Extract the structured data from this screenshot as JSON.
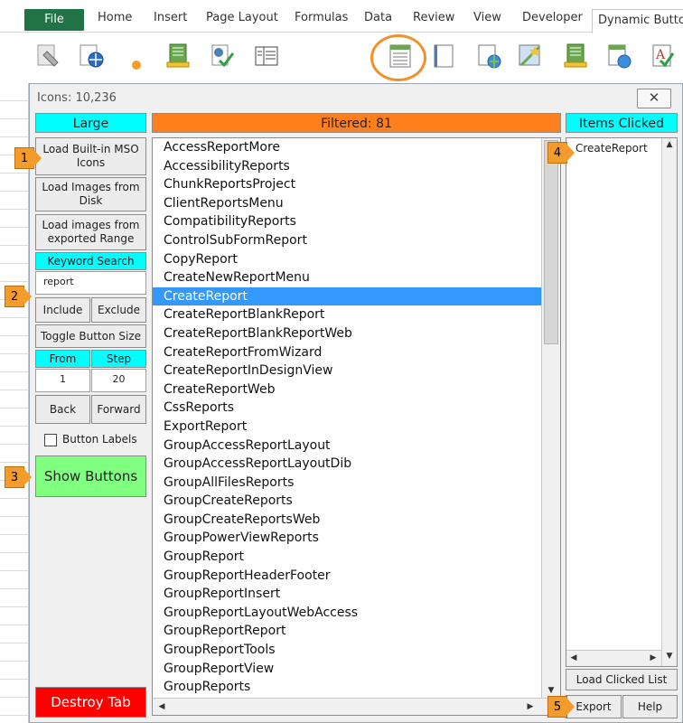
{
  "ribbon": {
    "tabs": [
      "File",
      "Home",
      "Insert",
      "Page Layout",
      "Formulas",
      "Data",
      "Review",
      "View",
      "Developer",
      "Dynamic Buttons"
    ],
    "accent": "#217346",
    "highlight_ring_color": "#f0922b"
  },
  "dialog": {
    "title": "Icons: 10,236",
    "close_label": "✕",
    "left": {
      "header": "Large",
      "load_mso": "Load Built-in MSO Icons",
      "load_disk": "Load Images from Disk",
      "load_range": "Load images from exported Range",
      "keyword_header": "Keyword Search",
      "keyword_value": "report",
      "include": "Include",
      "exclude": "Exclude",
      "toggle_size": "Toggle Button Size",
      "from_label": "From",
      "step_label": "Step",
      "from_value": "1",
      "step_value": "20",
      "back": "Back",
      "forward": "Forward",
      "button_labels": "Button Labels",
      "show_buttons": "Show Buttons",
      "destroy_tab": "Destroy Tab"
    },
    "filtered": {
      "header": "Filtered: 81",
      "items": [
        "AccessReportMore",
        "AccessibilityReports",
        "ChunkReportsProject",
        "ClientReportsMenu",
        "CompatibilityReports",
        "ControlSubFormReport",
        "CopyReport",
        "CreateNewReportMenu",
        "CreateReport",
        "CreateReportBlankReport",
        "CreateReportBlankReportWeb",
        "CreateReportFromWizard",
        "CreateReportInDesignView",
        "CreateReportWeb",
        "CssReports",
        "ExportReport",
        "GroupAccessReportLayout",
        "GroupAccessReportLayoutDib",
        "GroupAllFilesReports",
        "GroupCreateReports",
        "GroupCreateReportsWeb",
        "GroupPowerViewReports",
        "GroupReport",
        "GroupReportHeaderFooter",
        "GroupReportInsert",
        "GroupReportLayoutWebAccess",
        "GroupReportReport",
        "GroupReportTools",
        "GroupReportView",
        "GroupReports"
      ],
      "selected": "CreateReport"
    },
    "clicked": {
      "header": "Items Clicked",
      "items": [
        "CreateReport"
      ],
      "load_list": "Load Clicked List",
      "export": "Export",
      "help": "Help"
    },
    "callouts": [
      "1",
      "2",
      "3",
      "4",
      "5"
    ],
    "colors": {
      "cyan": "#00ffff",
      "orange": "#ff7f1c",
      "green": "#80ff80",
      "red": "#ff0000",
      "selection": "#3399ff"
    }
  }
}
